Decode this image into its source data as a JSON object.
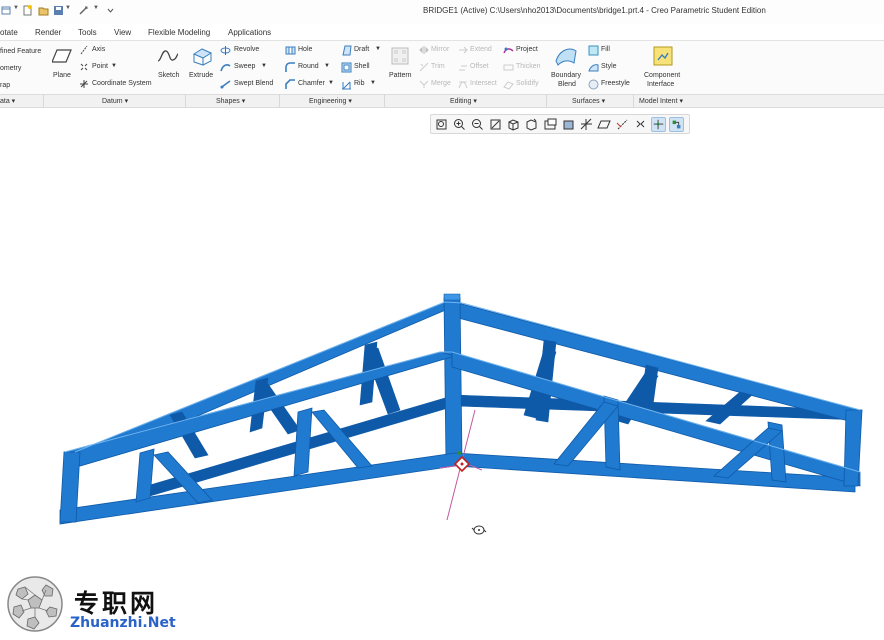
{
  "window": {
    "title": "BRIDGE1 (Active) C:\\Users\\nho2013\\Documents\\bridge1.prt.4 - Creo Parametric Student Edition"
  },
  "tabs": [
    "otate",
    "Render",
    "Tools",
    "View",
    "Flexible Modeling",
    "Applications"
  ],
  "ribbon": {
    "get_data": [
      "fined Feature",
      "ometry",
      "rap"
    ],
    "datum": {
      "plane": "Plane",
      "axis": "Axis",
      "point": "Point",
      "coord": "Coordinate System",
      "sketch": "Sketch"
    },
    "shapes": {
      "extrude": "Extrude",
      "revolve": "Revolve",
      "sweep": "Sweep",
      "swept_blend": "Swept Blend"
    },
    "engineering": {
      "hole": "Hole",
      "round": "Round",
      "chamfer": "Chamfer",
      "draft": "Draft",
      "shell": "Shell",
      "rib": "Rib"
    },
    "editing": {
      "pattern": "Pattern",
      "mirror": "Mirror",
      "trim": "Trim",
      "merge": "Merge",
      "extend": "Extend",
      "offset": "Offset",
      "intersect": "Intersect",
      "project": "Project",
      "thicken": "Thicken",
      "solidify": "Solidify"
    },
    "surfaces": {
      "boundary_blend_1": "Boundary",
      "boundary_blend_2": "Blend",
      "fill": "Fill",
      "style": "Style",
      "freestyle": "Freestyle"
    },
    "model_intent": {
      "component_1": "Component",
      "component_2": "Interface"
    }
  },
  "groups": [
    "ata",
    "Datum",
    "Shapes",
    "Engineering",
    "Editing",
    "Surfaces",
    "Model Intent"
  ],
  "colors": {
    "truss": "#1f7ad0",
    "truss_dark": "#0f5aa8",
    "truss_light": "#3d96e6"
  },
  "watermark": {
    "cn": "专职网",
    "en": "Zhuanzhi.Net"
  }
}
